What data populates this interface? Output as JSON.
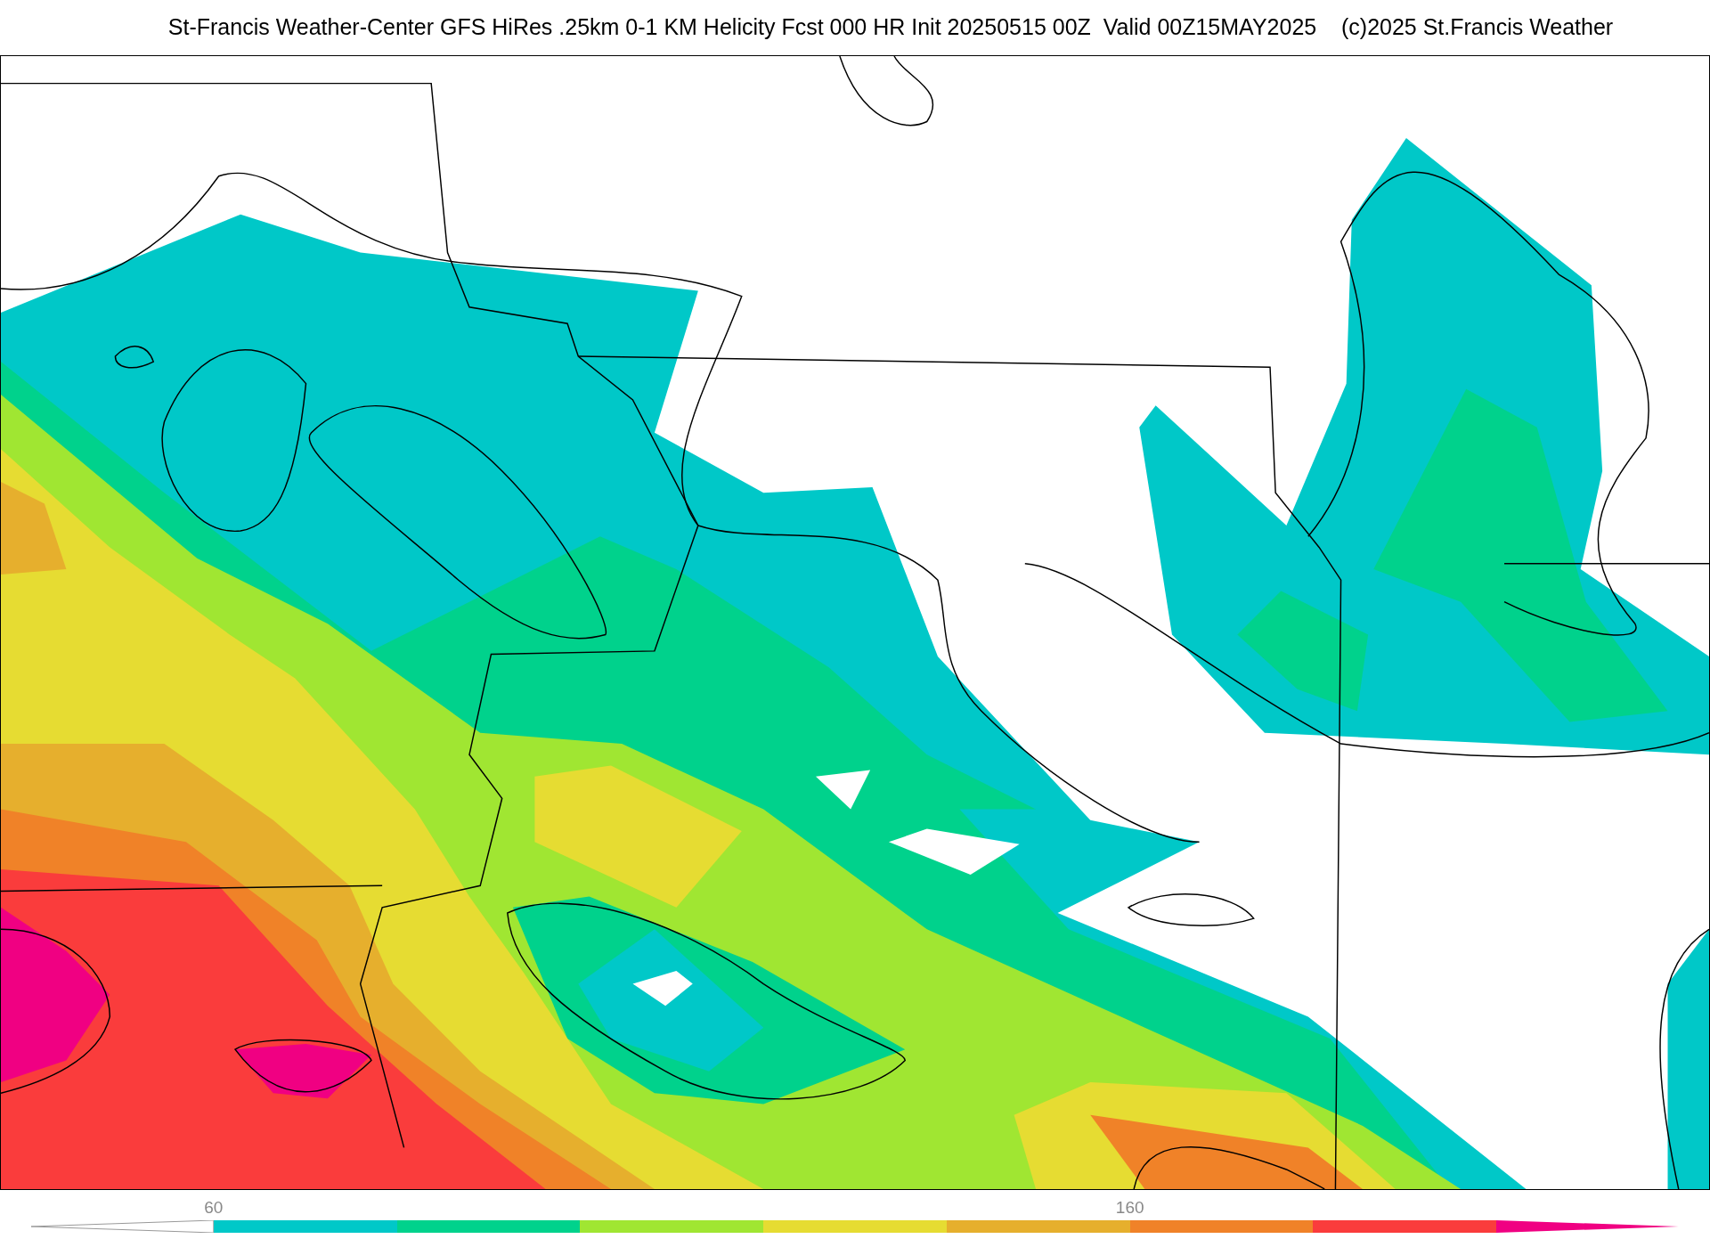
{
  "title": "St-Francis Weather-Center GFS HiRes .25km 0-1 KM Helicity Fcst 000 HR Init 20250515 00Z  Valid 00Z15MAY2025    (c)2025 St.Francis Weather",
  "colorbar": {
    "segments": [
      {
        "kind": "under"
      },
      {
        "color": "#00c8c8",
        "label": "60"
      },
      {
        "color": "#00d28c"
      },
      {
        "color": "#a0e632"
      },
      {
        "color": "#e6dc32"
      },
      {
        "color": "#e6af2d"
      },
      {
        "color": "#f08228",
        "label": "160"
      },
      {
        "color": "#fa3c3c"
      },
      {
        "kind": "over",
        "color": "#f00082"
      }
    ]
  }
}
